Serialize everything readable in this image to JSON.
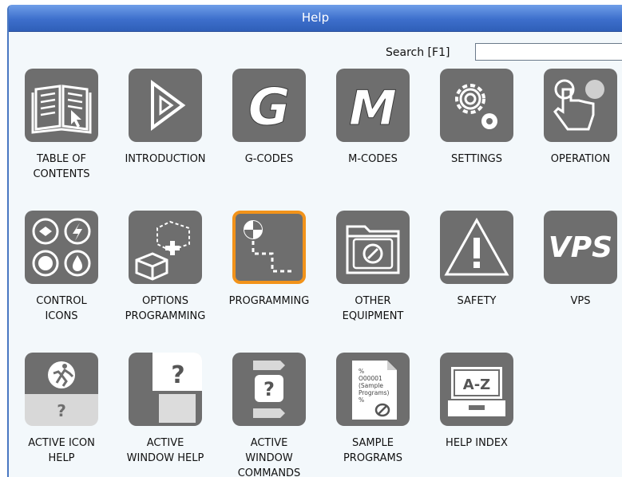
{
  "window": {
    "title": "Help"
  },
  "search": {
    "label": "Search [F1]",
    "value": ""
  },
  "tiles": [
    {
      "label": "TABLE OF\nCONTENTS",
      "icon": "book-icon"
    },
    {
      "label": "INTRODUCTION",
      "icon": "play-triangle-icon"
    },
    {
      "label": "G-CODES",
      "icon": "g-letter-icon",
      "glyph": "G"
    },
    {
      "label": "M-CODES",
      "icon": "m-letter-icon",
      "glyph": "M"
    },
    {
      "label": "SETTINGS",
      "icon": "gears-icon"
    },
    {
      "label": "OPERATION",
      "icon": "hand-touch-icon"
    },
    {
      "label": "CONTROL\nICONS",
      "icon": "control-icons-icon"
    },
    {
      "label": "OPTIONS\nPROGRAMMING",
      "icon": "add-box-icon"
    },
    {
      "label": "PROGRAMMING",
      "icon": "toolpath-icon",
      "selected": true
    },
    {
      "label": "OTHER\nEQUIPMENT",
      "icon": "folder-logo-icon"
    },
    {
      "label": "SAFETY",
      "icon": "warning-icon"
    },
    {
      "label": "VPS",
      "icon": "vps-icon",
      "glyph": "VPS"
    },
    {
      "label": "ACTIVE ICON\nHELP",
      "icon": "running-person-help-icon",
      "glyph": "?"
    },
    {
      "label": "ACTIVE\nWINDOW HELP",
      "icon": "window-help-icon",
      "glyph": "?"
    },
    {
      "label": "ACTIVE\nWINDOW\nCOMMANDS",
      "icon": "window-commands-icon",
      "glyph": "?"
    },
    {
      "label": "SAMPLE\nPROGRAMS",
      "icon": "sample-document-icon",
      "doc_lines": [
        "%",
        "O00001",
        "(Sample",
        "Programs)",
        "%"
      ]
    },
    {
      "label": "HELP INDEX",
      "icon": "index-drawer-icon",
      "glyph": "A-Z"
    }
  ],
  "colors": {
    "accent": "#3d6fcc",
    "selection": "#f2931a",
    "tile": "#6e6e6e"
  }
}
